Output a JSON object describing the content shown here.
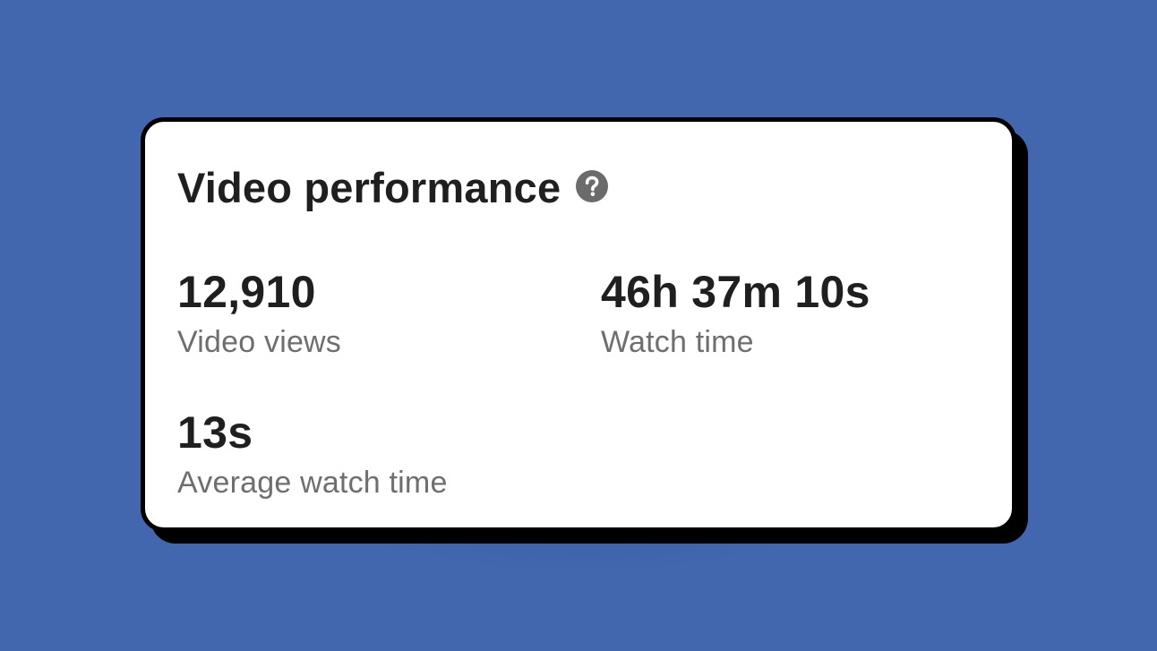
{
  "card": {
    "title": "Video performance",
    "help_icon": "question-circle-icon"
  },
  "stats": {
    "video_views": {
      "value": "12,910",
      "label": "Video views"
    },
    "watch_time": {
      "value": "46h 37m 10s",
      "label": "Watch time"
    },
    "average_watch_time": {
      "value": "13s",
      "label": "Average watch time"
    }
  },
  "colors": {
    "background": "#4267ae",
    "card": "#ffffff",
    "text_primary": "#1f1f1f",
    "text_secondary": "#6e6e6e",
    "icon": "#6b6b6b"
  }
}
